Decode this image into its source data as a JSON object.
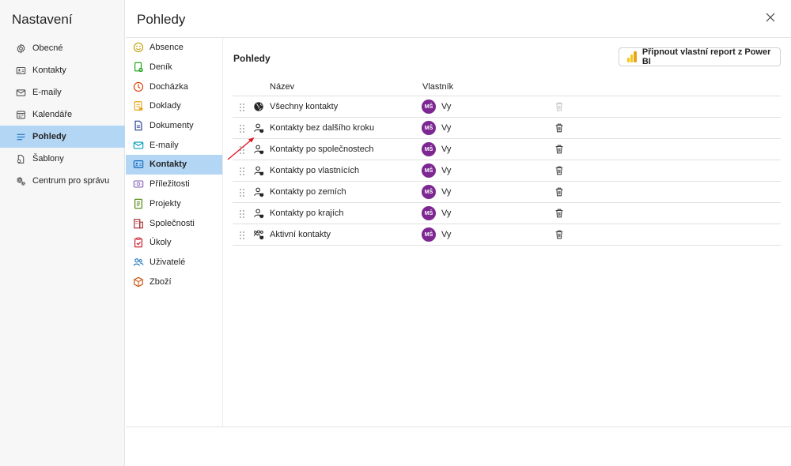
{
  "settings": {
    "title": "Nastavení",
    "items": [
      {
        "label": "Obecné",
        "icon": "gear-icon"
      },
      {
        "label": "Kontakty",
        "icon": "contact-card-icon"
      },
      {
        "label": "E-maily",
        "icon": "mail-icon"
      },
      {
        "label": "Kalendáře",
        "icon": "calendar-icon"
      },
      {
        "label": "Pohledy",
        "icon": "list-icon",
        "active": true
      },
      {
        "label": "Šablony",
        "icon": "template-icon"
      },
      {
        "label": "Centrum pro správu",
        "icon": "admin-gear-icon"
      }
    ]
  },
  "header": {
    "title": "Pohledy"
  },
  "entities": {
    "items": [
      {
        "label": "Absence",
        "icon": "smiley-icon",
        "color": "#c19c00"
      },
      {
        "label": "Deník",
        "icon": "diary-icon",
        "color": "#13a10e"
      },
      {
        "label": "Docházka",
        "icon": "clock-icon",
        "color": "#da3b01"
      },
      {
        "label": "Doklady",
        "icon": "documents-icon",
        "color": "#e8a317"
      },
      {
        "label": "Dokumenty",
        "icon": "document-icon",
        "color": "#1f3a93"
      },
      {
        "label": "E-maily",
        "icon": "mail-icon",
        "color": "#0099bc"
      },
      {
        "label": "Kontakty",
        "icon": "contact-card-icon",
        "color": "#0f6cbd",
        "active": true
      },
      {
        "label": "Příležitosti",
        "icon": "opportunity-icon",
        "color": "#8764b8"
      },
      {
        "label": "Projekty",
        "icon": "project-icon",
        "color": "#498205"
      },
      {
        "label": "Společnosti",
        "icon": "building-icon",
        "color": "#a4262c"
      },
      {
        "label": "Úkoly",
        "icon": "task-icon",
        "color": "#c50f1f"
      },
      {
        "label": "Uživatelé",
        "icon": "users-icon",
        "color": "#0f6cbd"
      },
      {
        "label": "Zboží",
        "icon": "box-icon",
        "color": "#ca5010"
      }
    ]
  },
  "content": {
    "title": "Pohledy",
    "powerbi_button": "Připnout vlastní report z Power BI",
    "columns": {
      "name": "Název",
      "owner": "Vlastník"
    },
    "rows": [
      {
        "name": "Všechny kontakty",
        "owner_initials": "MŠ",
        "owner": "Vy",
        "icon": "globe-icon",
        "deletable": false
      },
      {
        "name": "Kontakty bez dalšího kroku",
        "owner_initials": "MŠ",
        "owner": "Vy",
        "icon": "person-view-icon",
        "deletable": true
      },
      {
        "name": "Kontakty po společnostech",
        "owner_initials": "MŠ",
        "owner": "Vy",
        "icon": "person-view-icon",
        "deletable": true
      },
      {
        "name": "Kontakty po vlastnících",
        "owner_initials": "MŠ",
        "owner": "Vy",
        "icon": "person-view-icon",
        "deletable": true
      },
      {
        "name": "Kontakty po zemích",
        "owner_initials": "MŠ",
        "owner": "Vy",
        "icon": "person-view-icon",
        "deletable": true
      },
      {
        "name": "Kontakty po krajích",
        "owner_initials": "MŠ",
        "owner": "Vy",
        "icon": "person-view-icon",
        "deletable": true
      },
      {
        "name": "Aktivní kontakty",
        "owner_initials": "MŠ",
        "owner": "Vy",
        "icon": "group-view-icon",
        "deletable": true
      }
    ]
  },
  "colors": {
    "accent": "#b3d6f5",
    "avatar": "#7d2792",
    "annotation_arrow": "#e81123"
  }
}
